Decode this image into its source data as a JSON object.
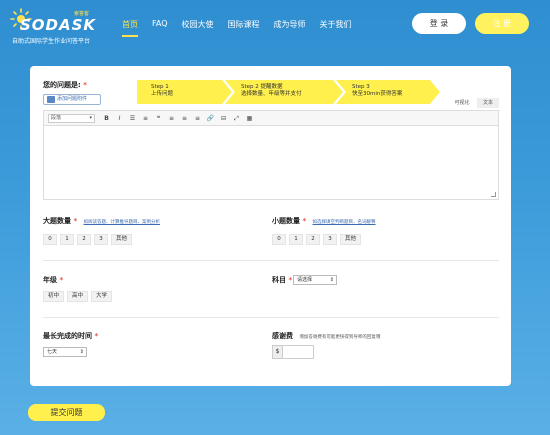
{
  "header": {
    "logo_text": "SODASK",
    "logo_small": "索答客",
    "logo_sub": "自助式国际学生作业问答平台",
    "nav": [
      "首页",
      "FAQ",
      "校园大使",
      "国际课程",
      "成为导师",
      "关于我们"
    ],
    "login": "登 录",
    "register": "注 册"
  },
  "question": {
    "label": "您的问题是:",
    "required_mark": "*",
    "attach": "添加问题附件",
    "steps": [
      {
        "title": "Step 1",
        "desc": "上传问题"
      },
      {
        "title": "Step 2  提醒数据",
        "desc": "选择数量、年级等并支付"
      },
      {
        "title": "Step 3",
        "desc": "快至30min获得答案"
      }
    ],
    "view_tabs": [
      "可视化",
      "文本"
    ],
    "format_select": "段落",
    "toolbar_icons": [
      {
        "name": "bold-icon",
        "glyph": "B"
      },
      {
        "name": "italic-icon",
        "glyph": "I"
      },
      {
        "name": "bullet-list-icon",
        "glyph": "☰"
      },
      {
        "name": "numbered-list-icon",
        "glyph": "≡"
      },
      {
        "name": "quote-icon",
        "glyph": "❝"
      },
      {
        "name": "align-left-icon",
        "glyph": "≡"
      },
      {
        "name": "align-center-icon",
        "glyph": "≡"
      },
      {
        "name": "align-right-icon",
        "glyph": "≡"
      },
      {
        "name": "link-icon",
        "glyph": "🔗"
      },
      {
        "name": "unlink-icon",
        "glyph": "⊟"
      },
      {
        "name": "fullscreen-icon",
        "glyph": "⤢"
      },
      {
        "name": "table-icon",
        "glyph": "▦"
      }
    ]
  },
  "big_q": {
    "label": "大题数量",
    "hint": "如阅读答题、计算推导题目、案例分析",
    "options": [
      "0",
      "1",
      "2",
      "3",
      "其他"
    ]
  },
  "small_q": {
    "label": "小题数量",
    "hint": "如选择填空判断题目、名词解释",
    "options": [
      "0",
      "1",
      "2",
      "3",
      "其他"
    ]
  },
  "grade": {
    "label": "年级",
    "options": [
      "初中",
      "高中",
      "大学"
    ]
  },
  "subject": {
    "label": "科目",
    "placeholder": "请选择"
  },
  "deadline": {
    "label": "最长完成的时间",
    "value": "七天"
  },
  "fee": {
    "label": "感谢费",
    "hint": "增加答谢费有可能更快得到导师的回复哦",
    "currency": "$"
  },
  "submit": "提交问题"
}
